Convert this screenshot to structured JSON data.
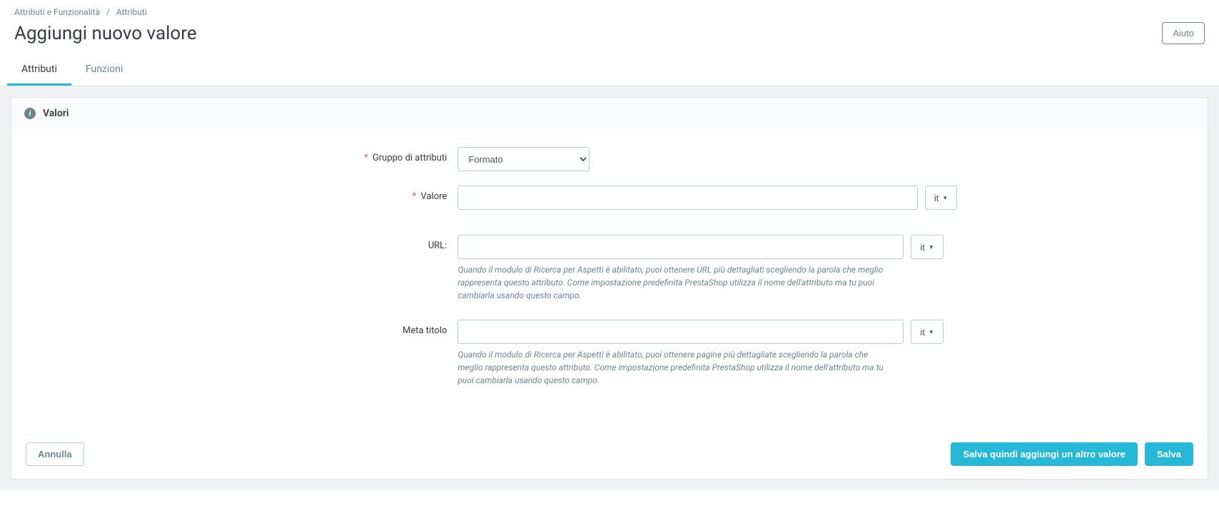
{
  "breadcrumb": {
    "parent": "Attributi e Funzionalità",
    "current": "Attributi"
  },
  "header": {
    "title": "Aggiungi nuovo valore",
    "help": "Aiuto"
  },
  "tabs": {
    "active": "Attributi",
    "other": "Funzioni"
  },
  "panel": {
    "title": "Valori"
  },
  "form": {
    "group_label": "Gruppo di attributi",
    "group_value": "Formato",
    "value_label": "Valore",
    "value_input": "",
    "url_label": "URL:",
    "url_input": "",
    "url_help": "Quando il modulo di Ricerca per Aspetti è abilitato, puoi ottenere URL più dettagliati scegliendo la parola che meglio rappresenta questo attributo. Come impostazione predefinita PrestaShop utilizza il nome dell'attributo ma tu puoi cambiarla usando questo campo.",
    "meta_label": "Meta titolo",
    "meta_input": "",
    "meta_help": "Quando il modulo di Ricerca per Aspetti è abilitato, puoi ottenere pagine più dettagliate scegliendo la parola che meglio rappresenta questo attributo. Come impostazione predefinita PrestaShop utilizza il nome dell'attributo ma tu puoi cambiarla usando questo campo.",
    "lang": "it"
  },
  "footer": {
    "cancel": "Annulla",
    "save_another": "Salva quindi aggiungi un altro valore",
    "save": "Salva"
  }
}
